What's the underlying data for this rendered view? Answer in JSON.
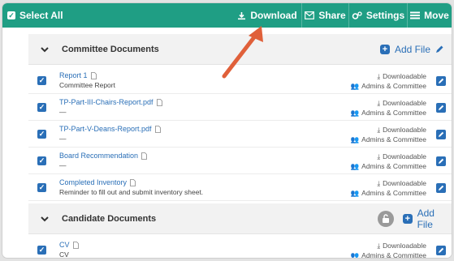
{
  "toolbar": {
    "select_all": "Select All",
    "download": "Download",
    "share": "Share",
    "settings": "Settings",
    "move": "Move",
    "color": "#1f9e84"
  },
  "sections": [
    {
      "title": "Committee Documents",
      "add_file": "Add File",
      "rows": [
        {
          "title": "Report 1",
          "subtitle": "Committee Report",
          "status": "Downloadable",
          "access": "Admins & Committee"
        },
        {
          "title": "TP-Part-III-Chairs-Report.pdf",
          "subtitle": "—",
          "status": "Downloadable",
          "access": "Admins & Committee"
        },
        {
          "title": "TP-Part-V-Deans-Report.pdf",
          "subtitle": "—",
          "status": "Downloadable",
          "access": "Admins & Committee"
        },
        {
          "title": "Board Recommendation",
          "subtitle": "—",
          "status": "Downloadable",
          "access": "Admins & Committee"
        },
        {
          "title": "Completed Inventory",
          "subtitle": "Reminder to fill out and submit inventory sheet.",
          "status": "Downloadable",
          "access": "Admins & Committee"
        }
      ]
    },
    {
      "title": "Candidate Documents",
      "add_file": "Add File",
      "rows": [
        {
          "title": "CV",
          "subtitle": "CV",
          "status": "Downloadable",
          "access": "Admins & Committee"
        }
      ]
    }
  ],
  "colors": {
    "link": "#2a6fb7",
    "annotation_arrow": "#e0603a"
  }
}
